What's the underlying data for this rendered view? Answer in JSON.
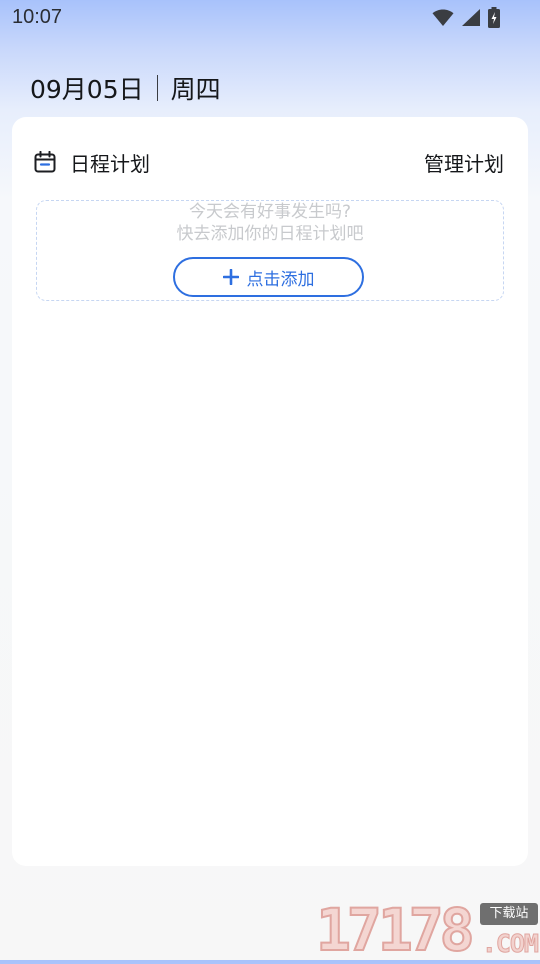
{
  "status_bar": {
    "time": "10:07",
    "icons": [
      "wifi-icon",
      "cellular-signal-icon",
      "battery-charging-icon"
    ]
  },
  "header": {
    "date": "09月05日",
    "weekday": "周四"
  },
  "schedule_card": {
    "icon": "calendar-icon",
    "title": "日程计划",
    "manage_label": "管理计划",
    "empty_state": {
      "line1": "今天会有好事发生吗?",
      "line2": "快去添加你的日程计划吧",
      "add_button_label": "点击添加",
      "add_icon": "plus-icon"
    }
  },
  "watermark": {
    "digits": "17178",
    "tag": "下载站",
    "suffix": ".COM"
  },
  "colors": {
    "accent": "#2e6fe0",
    "empty_text": "#c8cacd",
    "dashed_border": "#c6d6f2",
    "gradient_top": "#a8c2fb"
  }
}
